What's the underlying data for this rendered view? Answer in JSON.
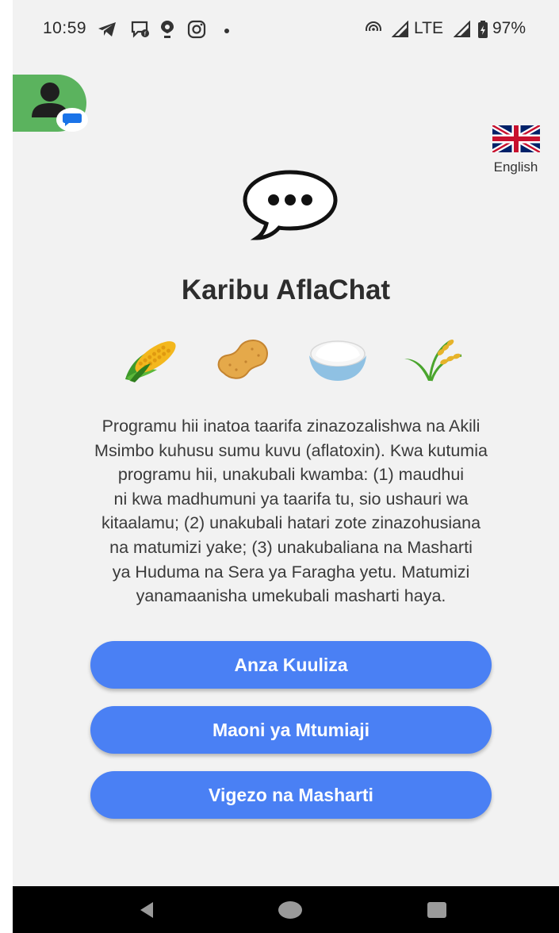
{
  "status_bar": {
    "time": "10:59",
    "network": "LTE",
    "battery": "97%",
    "icons": [
      "telegram-icon",
      "chat-icon",
      "location-pin-icon",
      "instagram-icon",
      "notification-dot",
      "hotspot-icon",
      "signal-icon",
      "signal-icon",
      "battery-icon"
    ]
  },
  "header": {
    "avatar_icon": "person-icon",
    "badge_icon": "message-icon",
    "language": {
      "label": "English",
      "flag_icon": "uk-flag-icon"
    }
  },
  "main": {
    "logo_icon": "speech-bubble-icon",
    "title": "Karibu AflaChat",
    "crop_icons": [
      "corn-icon",
      "peanut-icon",
      "rice-bowl-icon",
      "wheat-icon"
    ],
    "description_lines": [
      "Programu hii inatoa taarifa zinazozalishwa na Akili",
      "Msimbo kuhusu sumu kuvu (aflatoxin). Kwa kutumia",
      "programu hii, unakubali kwamba: (1) maudhui",
      "ni kwa madhumuni ya taarifa tu, sio ushauri wa",
      "kitaalamu; (2) unakubali hatari zote zinazohusiana",
      "na matumizi yake; (3) unakubaliana na Masharti",
      "ya Huduma na Sera ya Faragha yetu. Matumizi",
      "yanamaanisha umekubali masharti haya."
    ]
  },
  "buttons": {
    "start": "Anza Kuuliza",
    "feedback": "Maoni ya Mtumiaji",
    "terms": "Vigezo na Masharti"
  },
  "nav_bar": {
    "icons": [
      "back-icon",
      "home-icon",
      "recents-icon"
    ]
  },
  "colors": {
    "background": "#f2f2f2",
    "button": "#4a80f4",
    "avatar": "#5bb35e",
    "title": "#2d2d2d"
  }
}
